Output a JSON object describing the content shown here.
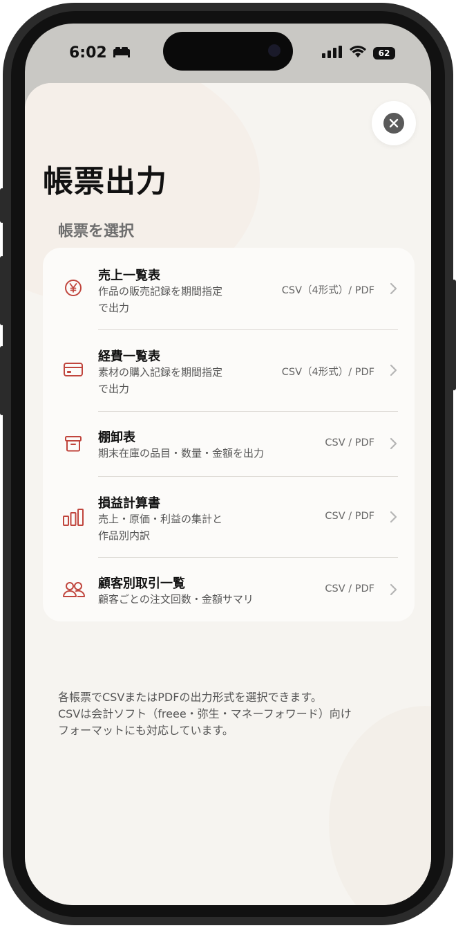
{
  "status_bar": {
    "time": "6:02",
    "battery_level": "62"
  },
  "sheet": {
    "title": "帳票出力",
    "section_label": "帳票を選択",
    "close_icon": "close-icon",
    "reports": [
      {
        "icon": "yen-icon",
        "name": "売上一覧表",
        "desc_lines": [
          "作品の販売記録を期間指定",
          "で出力"
        ],
        "format": "CSV（4形式）/ PDF"
      },
      {
        "icon": "credit-card-icon",
        "name": "経費一覧表",
        "desc_lines": [
          "素材の購入記録を期間指定",
          "で出力"
        ],
        "format": "CSV（4形式）/ PDF"
      },
      {
        "icon": "archive-box-icon",
        "name": "棚卸表",
        "desc_lines": [
          "期末在庫の品目・数量・金額を出力"
        ],
        "format": "CSV / PDF"
      },
      {
        "icon": "bar-chart-icon",
        "name": "損益計算書",
        "desc_lines": [
          "売上・原価・利益の集計と",
          "作品別内訳"
        ],
        "format": "CSV / PDF"
      },
      {
        "icon": "people-icon",
        "name": "顧客別取引一覧",
        "desc_lines": [
          "顧客ごとの注文回数・金額サマリ"
        ],
        "format": "CSV / PDF"
      }
    ],
    "note_lines": [
      "各帳票でCSVまたはPDFの出力形式を選択できます。",
      "CSVは会計ソフト（freee・弥生・マネーフォワード）向け",
      "フォーマットにも対応しています。"
    ]
  },
  "colors": {
    "accent": "#c0453d",
    "sheet_bg": "#f6f4f0",
    "card_bg": "#fcfbf9"
  }
}
